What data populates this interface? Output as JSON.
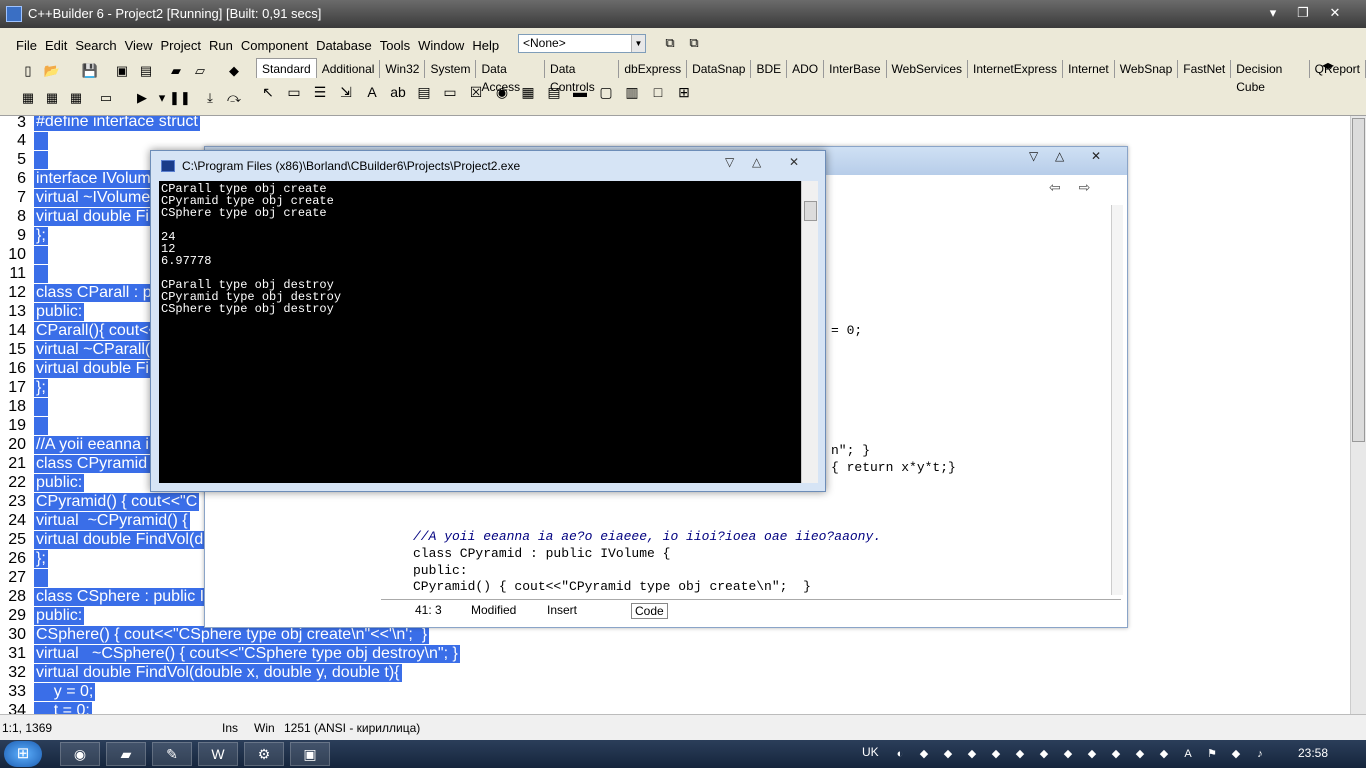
{
  "window": {
    "title": "C++Builder 6 - Project2 [Running] [Built: 0,91 secs]",
    "minimize": "▾",
    "maximize": "❐",
    "close": "✕"
  },
  "menu": [
    "File",
    "Edit",
    "Search",
    "View",
    "Project",
    "Run",
    "Component",
    "Database",
    "Tools",
    "Window",
    "Help"
  ],
  "toolbar": {
    "combo_value": "<None>"
  },
  "palette": {
    "tabs": [
      "Standard",
      "Additional",
      "Win32",
      "System",
      "Data Access",
      "Data Controls",
      "dbExpress",
      "DataSnap",
      "BDE",
      "ADO",
      "InterBase",
      "WebServices",
      "InternetExpress",
      "Internet",
      "WebSnap",
      "FastNet",
      "Decision Cube",
      "QReport"
    ],
    "active_tab": "Standard"
  },
  "editor": {
    "line_numbers": [
      "3",
      "4",
      "5",
      "6",
      "7",
      "8",
      "9",
      "10",
      "11",
      "12",
      "13",
      "14",
      "15",
      "16",
      "17",
      "18",
      "19",
      "20",
      "21",
      "22",
      "23",
      "24",
      "25",
      "26",
      "27",
      "28",
      "29",
      "30",
      "31",
      "32",
      "33",
      "34"
    ],
    "lines": [
      "#define interface struct",
      "",
      "",
      "interface IVolume",
      "virtual ~IVolume",
      "virtual double Fi",
      "};",
      "",
      "",
      "class CParall : pu",
      "public:",
      "CParall(){ cout<<",
      "virtual ~CParall(",
      "virtual double Fi",
      "};",
      "",
      "",
      "//A yoii eeanna i",
      "class CPyramid :",
      "public:",
      "CPyramid() { cout<<\"C",
      "virtual  ~CPyramid() {",
      "virtual double FindVol(d",
      "};",
      "",
      "class CSphere : public I",
      "public:",
      "CSphere() { cout<<\"CSphere type obj create\\n\"<<'\\n';  }",
      "virtual   ~CSphere() { cout<<\"CSphere type obj destroy\\n\"; }",
      "virtual double FindVol(double x, double y, double t){",
      "    y = 0;",
      "    t = 0;"
    ]
  },
  "status": {
    "pos": "1:1, 1369",
    "mode": "Ins",
    "encoding_label": "Win",
    "codepage": "1251",
    "charset": "(ANSI - кириллица)"
  },
  "code_window": {
    "nav_back": "⇦",
    "nav_fwd": "⇨",
    "snippets": [
      "= 0;",
      "n\"; }",
      "{ return x*y*t;}",
      "//A yoii eeanna ia ae?o eiaeee, io iioi?ioea oae iieo?aaony.",
      "class CPyramid : public IVolume {",
      "public:",
      "CPyramid() { cout<<\"CPyramid type obj create\\n\";  }"
    ],
    "status_pos": "41:  3",
    "status_modified": "Modified",
    "status_insert": "Insert",
    "tab_code": "Code"
  },
  "console": {
    "title": "C:\\Program Files (x86)\\Borland\\CBuilder6\\Projects\\Project2.exe",
    "lines": [
      "CParall type obj create",
      "CPyramid type obj create",
      "CSphere type obj create",
      "",
      "24",
      "12",
      "6.97778",
      "",
      "CParall type obj destroy",
      "CPyramid type obj destroy",
      "CSphere type obj destroy"
    ]
  },
  "taskbar": {
    "start": "⊞",
    "language": "UK",
    "clock": "23:58"
  },
  "colors": {
    "selection": "#3a6ee8",
    "console_bg": "#000000",
    "taskbar": "#1e3150"
  }
}
